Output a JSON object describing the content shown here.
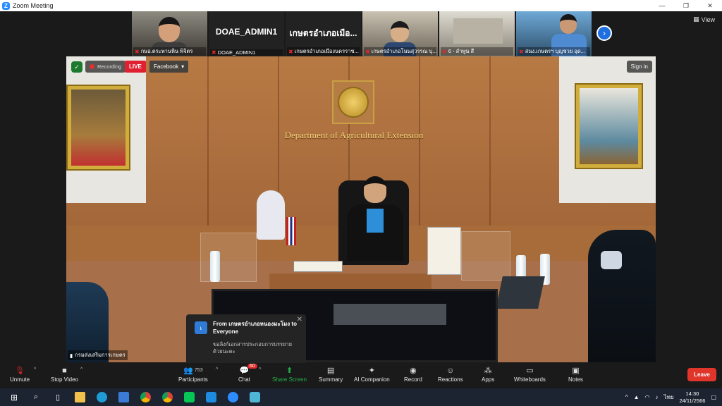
{
  "window": {
    "title": "Zoom Meeting",
    "logo_letter": "Z",
    "minimize": "—",
    "maximize": "❐",
    "close": "✕"
  },
  "gallery": {
    "participants": [
      {
        "name": "กษอ.ตระพานหิน พิจิตร",
        "label": "",
        "video": true
      },
      {
        "name": "DOAE_ADMIN1",
        "label": "DOAE_ADMIN1",
        "video": false
      },
      {
        "name": "เกษตรอำเภอเมืองนครราช...",
        "label": "เกษตรอำเภอเมือ...",
        "video": false
      },
      {
        "name": "เกษตรอำเภอโนนสุวรรณ บุ...",
        "label": "",
        "video": true
      },
      {
        "name": "6 - ลำพูน สี",
        "label": "",
        "video": true
      },
      {
        "name": "สนง.เกษตรฯ บุญชวย อุด...",
        "label": "",
        "video": true
      }
    ],
    "next_icon": "›",
    "view_label": "View"
  },
  "main_video": {
    "wall_sign": "Department of Agricultural Extension",
    "recording_label": "Recording",
    "live_label": "LIVE",
    "facebook_label": "Facebook",
    "signin_label": "Sign in",
    "speaker_name": "กรมส่งเสริมการเกษตร"
  },
  "chat_popup": {
    "avatar_letter": "เ",
    "from_line": "From เกษตรอำเภอหนองมะโมง to Everyone",
    "message": "ขอลิงก์เอกสารประกอบการบรรยายด้วยนะคะ",
    "close_icon": "✕"
  },
  "toolbar": {
    "unmute": "Unmute",
    "stop_video": "Stop Video",
    "participants": "Participants",
    "participants_count": "753",
    "chat": "Chat",
    "chat_badge": "60",
    "share_screen": "Share Screen",
    "summary": "Summary",
    "ai_companion": "AI Companion",
    "record": "Record",
    "reactions": "Reactions",
    "apps": "Apps",
    "whiteboards": "Whiteboards",
    "notes": "Notes",
    "leave": "Leave"
  },
  "taskbar": {
    "language": "ไทย",
    "time": "14:30",
    "date": "24/11/2566"
  },
  "colors": {
    "accent": "#2d8cff",
    "live": "#e02030",
    "leave": "#e0352b",
    "share": "#23b24a"
  }
}
